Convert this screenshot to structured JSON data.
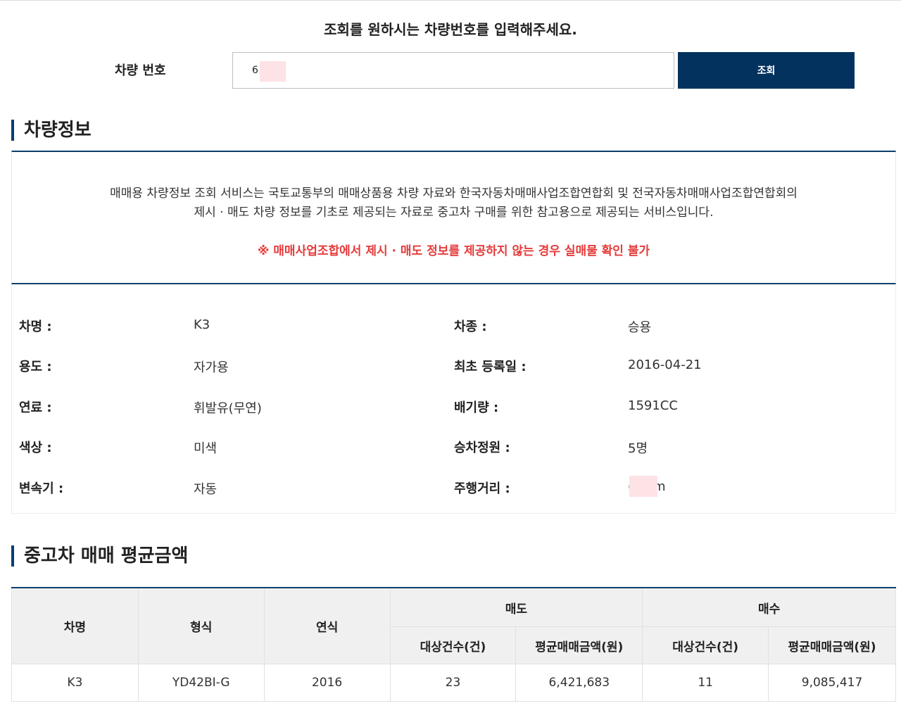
{
  "lookup": {
    "prompt": "조회를 원하시는 차량번호를 입력해주세요.",
    "label": "차량 번호",
    "input_value": "62    18",
    "button": "조회"
  },
  "vehicle_info": {
    "title": "차량정보",
    "notice_line1": "매매용 차량정보 조회 서비스는 국토교통부의 매매상품용 차량 자료와 한국자동차매매사업조합연합회 및 전국자동차매매사업조합연합회의",
    "notice_line2": "제시 · 매도 차량 정보를 기초로 제공되는 자료로 중고차 구매를 위한 참고용으로 제공되는 서비스입니다.",
    "warning": "※ 매매사업조합에서 제시 · 매도 정보를 제공하지 않는 경우 실매물 확인 불가",
    "fields": [
      {
        "label": "차명 :",
        "value": "K3"
      },
      {
        "label": "차종 :",
        "value": "승용"
      },
      {
        "label": "용도 :",
        "value": "자가용"
      },
      {
        "label": "최초 등록일 :",
        "value": "2016-04-21"
      },
      {
        "label": "연료 :",
        "value": "휘발유(무연)"
      },
      {
        "label": "배기량 :",
        "value": "1591CC"
      },
      {
        "label": "색상 :",
        "value": "미색"
      },
      {
        "label": "승차정원 :",
        "value": "5명"
      },
      {
        "label": "변속기 :",
        "value": "자동"
      },
      {
        "label": "주행거리 :",
        "value": "(     5Km"
      }
    ]
  },
  "avg_price": {
    "title": "중고차 매매 평균금액",
    "headers": {
      "name": "차명",
      "model": "형식",
      "year": "연식",
      "sell": "매도",
      "buy": "매수",
      "sell_count": "대상건수(건)",
      "sell_avg": "평균매매금액(원)",
      "buy_count": "대상건수(건)",
      "buy_avg": "평균매매금액(원)"
    },
    "row": {
      "name": "K3",
      "model": "YD42BI-G",
      "year": "2016",
      "sell_count": "23",
      "sell_avg": "6,421,683",
      "buy_count": "11",
      "buy_avg": "9,085,417"
    }
  }
}
